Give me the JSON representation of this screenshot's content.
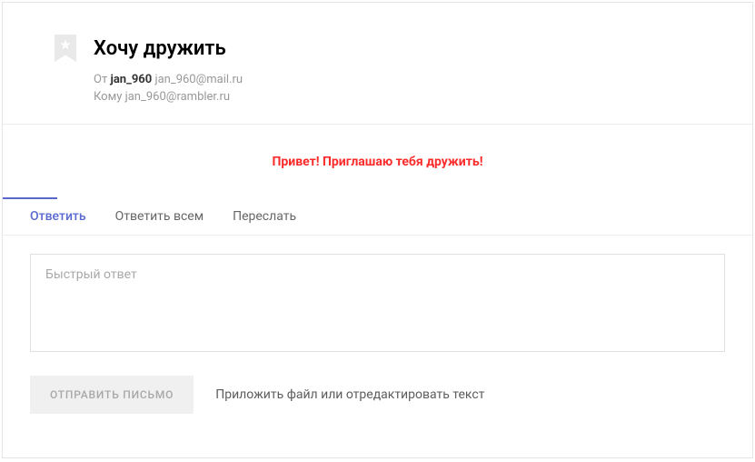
{
  "email": {
    "subject": "Хочу дружить",
    "from_label": "От",
    "from_name": "jan_960",
    "from_email": "jan_960@mail.ru",
    "to_label": "Кому",
    "to_email": "jan_960@rambler.ru",
    "body": "Привет! Приглашаю тебя дружить!"
  },
  "tabs": {
    "reply": "Ответить",
    "reply_all": "Ответить всем",
    "forward": "Переслать"
  },
  "reply": {
    "placeholder": "Быстрый ответ",
    "value": ""
  },
  "actions": {
    "send": "ОТПРАВИТЬ ПИСЬМО",
    "attach": "Приложить файл или отредактировать текст"
  }
}
